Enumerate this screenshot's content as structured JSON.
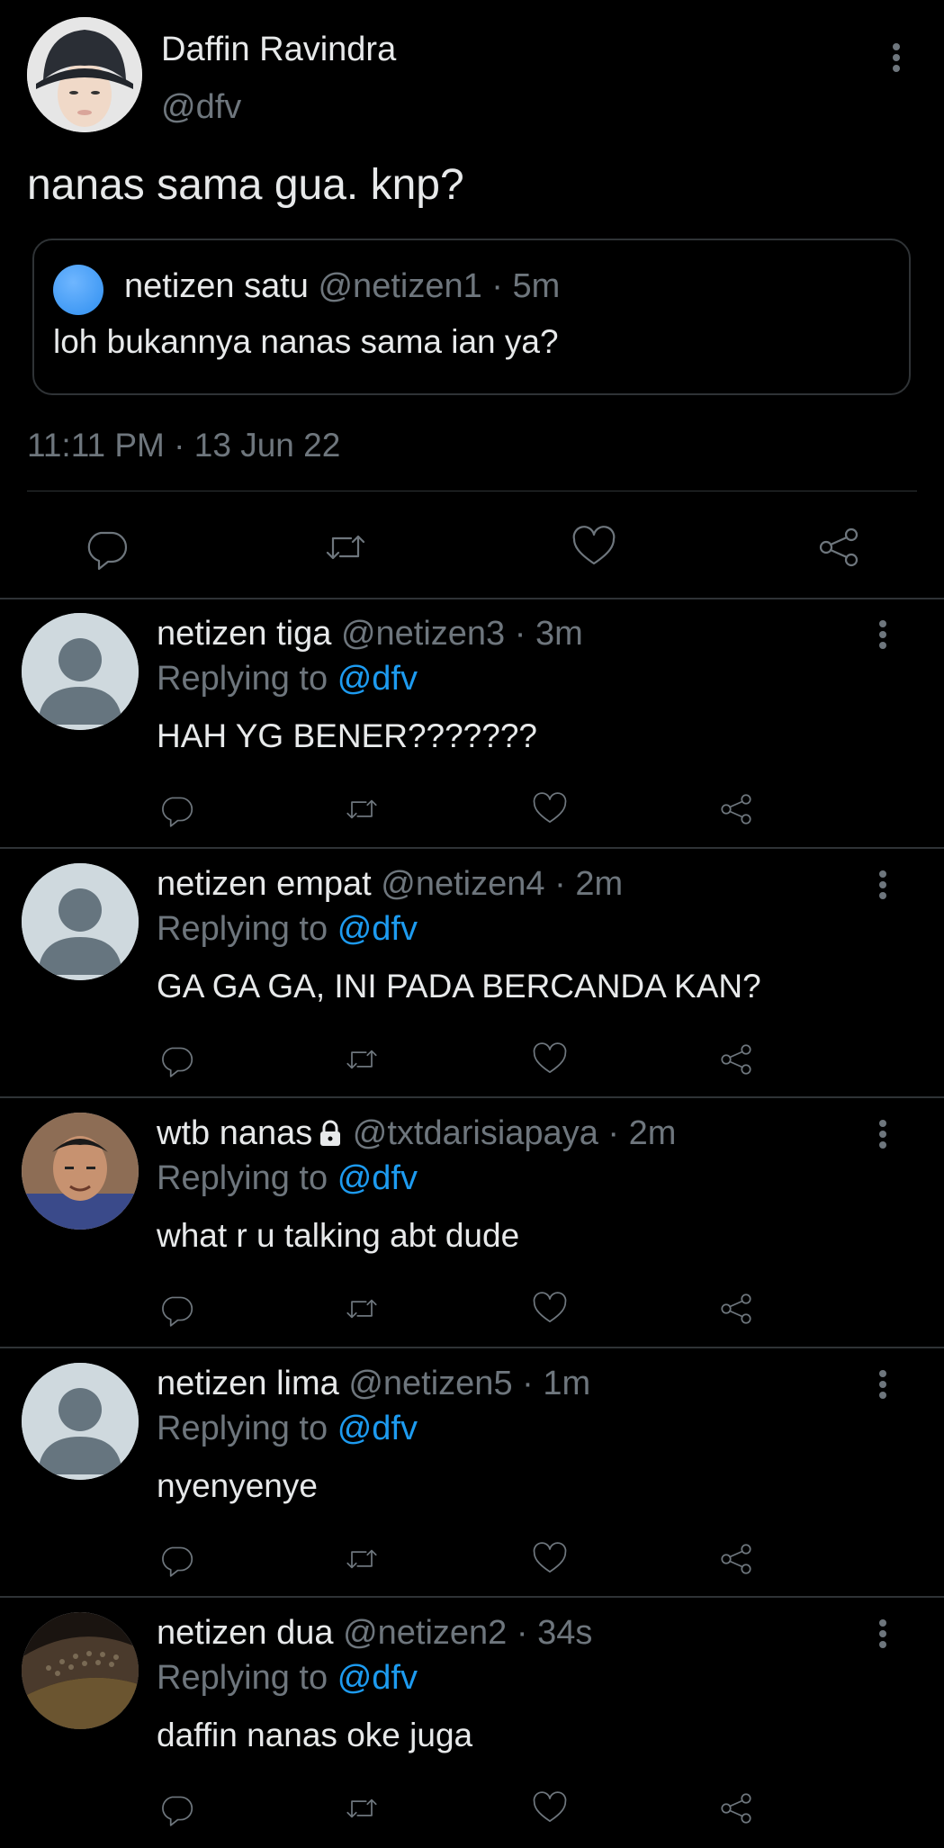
{
  "main_tweet": {
    "author_name": "Daffin Ravindra",
    "author_handle": "@dfv",
    "text": "nanas sama gua. knp?",
    "quote": {
      "author_name": "netizen satu",
      "author_handle": "@netizen1",
      "time": "5m",
      "text": "loh bukannya nanas sama ian ya?"
    },
    "timestamp": "11:11 PM · 13 Jun 22",
    "actions": [
      "reply-icon",
      "retweet-icon",
      "like-icon",
      "share-icon"
    ]
  },
  "replies": [
    {
      "name": "netizen tiga",
      "handle": "@netizen3",
      "time": "3m",
      "replying_label": "Replying to",
      "replying_handle": "@dfv",
      "text": "HAH YG BENER???????",
      "avatar": "default-avatar",
      "locked": false
    },
    {
      "name": "netizen empat",
      "handle": "@netizen4",
      "time": "2m",
      "replying_label": "Replying to",
      "replying_handle": "@dfv",
      "text": "GA GA GA, INI PADA BERCANDA KAN?",
      "avatar": "default-avatar",
      "locked": false
    },
    {
      "name": "wtb nanas",
      "handle": "@txtdarisiapaya",
      "time": "2m",
      "replying_label": "Replying to",
      "replying_handle": "@dfv",
      "text": "what r u talking abt dude",
      "avatar": "photo-avatar",
      "locked": true
    },
    {
      "name": "netizen lima",
      "handle": "@netizen5",
      "time": "1m",
      "replying_label": "Replying to",
      "replying_handle": "@dfv",
      "text": "nyenyenye",
      "avatar": "default-avatar",
      "locked": false
    },
    {
      "name": "netizen dua",
      "handle": "@netizen2",
      "time": "34s",
      "replying_label": "Replying to",
      "replying_handle": "@dfv",
      "text": "daffin nanas oke juga",
      "avatar": "photo-avatar",
      "locked": false
    }
  ],
  "separator": "·",
  "colors": {
    "background": "#000000",
    "text": "#e7e9ea",
    "muted": "#6e767d",
    "link": "#1d9bf0",
    "divider": "#2f3336"
  }
}
